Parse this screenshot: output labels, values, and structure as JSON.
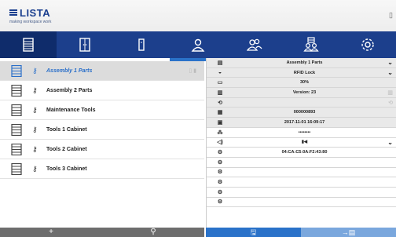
{
  "app": {
    "logo_word": "LISTA",
    "logo_tagline": "making workspace work",
    "top_right_icon": "info-icon"
  },
  "nav": {
    "tabs": [
      {
        "name": "cabinet-list-icon",
        "underline": ""
      },
      {
        "name": "door-icon",
        "underline": ""
      },
      {
        "name": "drawer-icon",
        "underline": ""
      },
      {
        "name": "user-icon",
        "underline": "#2a72c9"
      },
      {
        "name": "users-icon",
        "underline": "#3aa0d8"
      },
      {
        "name": "group-cabinet-icon",
        "underline": "#8ab83a"
      },
      {
        "name": "settings-icon",
        "underline": ""
      }
    ],
    "active_index": 0
  },
  "cabinets": [
    {
      "label": "Assembly 1 Parts",
      "selected": true
    },
    {
      "label": "Assembly 2 Parts",
      "selected": false
    },
    {
      "label": "Maintenance Tools",
      "selected": false
    },
    {
      "label": "Tools 1 Cabinet",
      "selected": false
    },
    {
      "label": "Tools 2 Cabinet",
      "selected": false
    },
    {
      "label": "Tools 3 Cabinet",
      "selected": false
    }
  ],
  "left_footer": {
    "add": "+",
    "search": "⚲"
  },
  "details": [
    {
      "icon": "cabinet-icon",
      "value": "Assembly 1 Parts",
      "chevron": true
    },
    {
      "icon": "lock-icon",
      "value": "RFID Lock",
      "chevron": true
    },
    {
      "icon": "battery-icon",
      "value": "30%"
    },
    {
      "icon": "firmware-icon",
      "value": "Version: 23",
      "ghost": true
    },
    {
      "icon": "sync-icon",
      "value": "",
      "ghost": true
    },
    {
      "icon": "serial-icon",
      "value": "000000893"
    },
    {
      "icon": "calendar-icon",
      "value": "2017-11-01 16:09:17"
    },
    {
      "icon": "password-icon",
      "value": "••••••••"
    },
    {
      "icon": "volume-icon",
      "value": "▮◀",
      "chevron": true
    },
    {
      "icon": "network-icon",
      "value": "04:CA:C5:0A:F2:43:80"
    },
    {
      "icon": "network-icon",
      "value": ""
    },
    {
      "icon": "network-icon",
      "value": ""
    },
    {
      "icon": "network-icon",
      "value": ""
    },
    {
      "icon": "network-icon",
      "value": ""
    },
    {
      "icon": "network-icon",
      "value": ""
    }
  ],
  "right_footer": {
    "save": "🖫",
    "next": "→▤"
  }
}
